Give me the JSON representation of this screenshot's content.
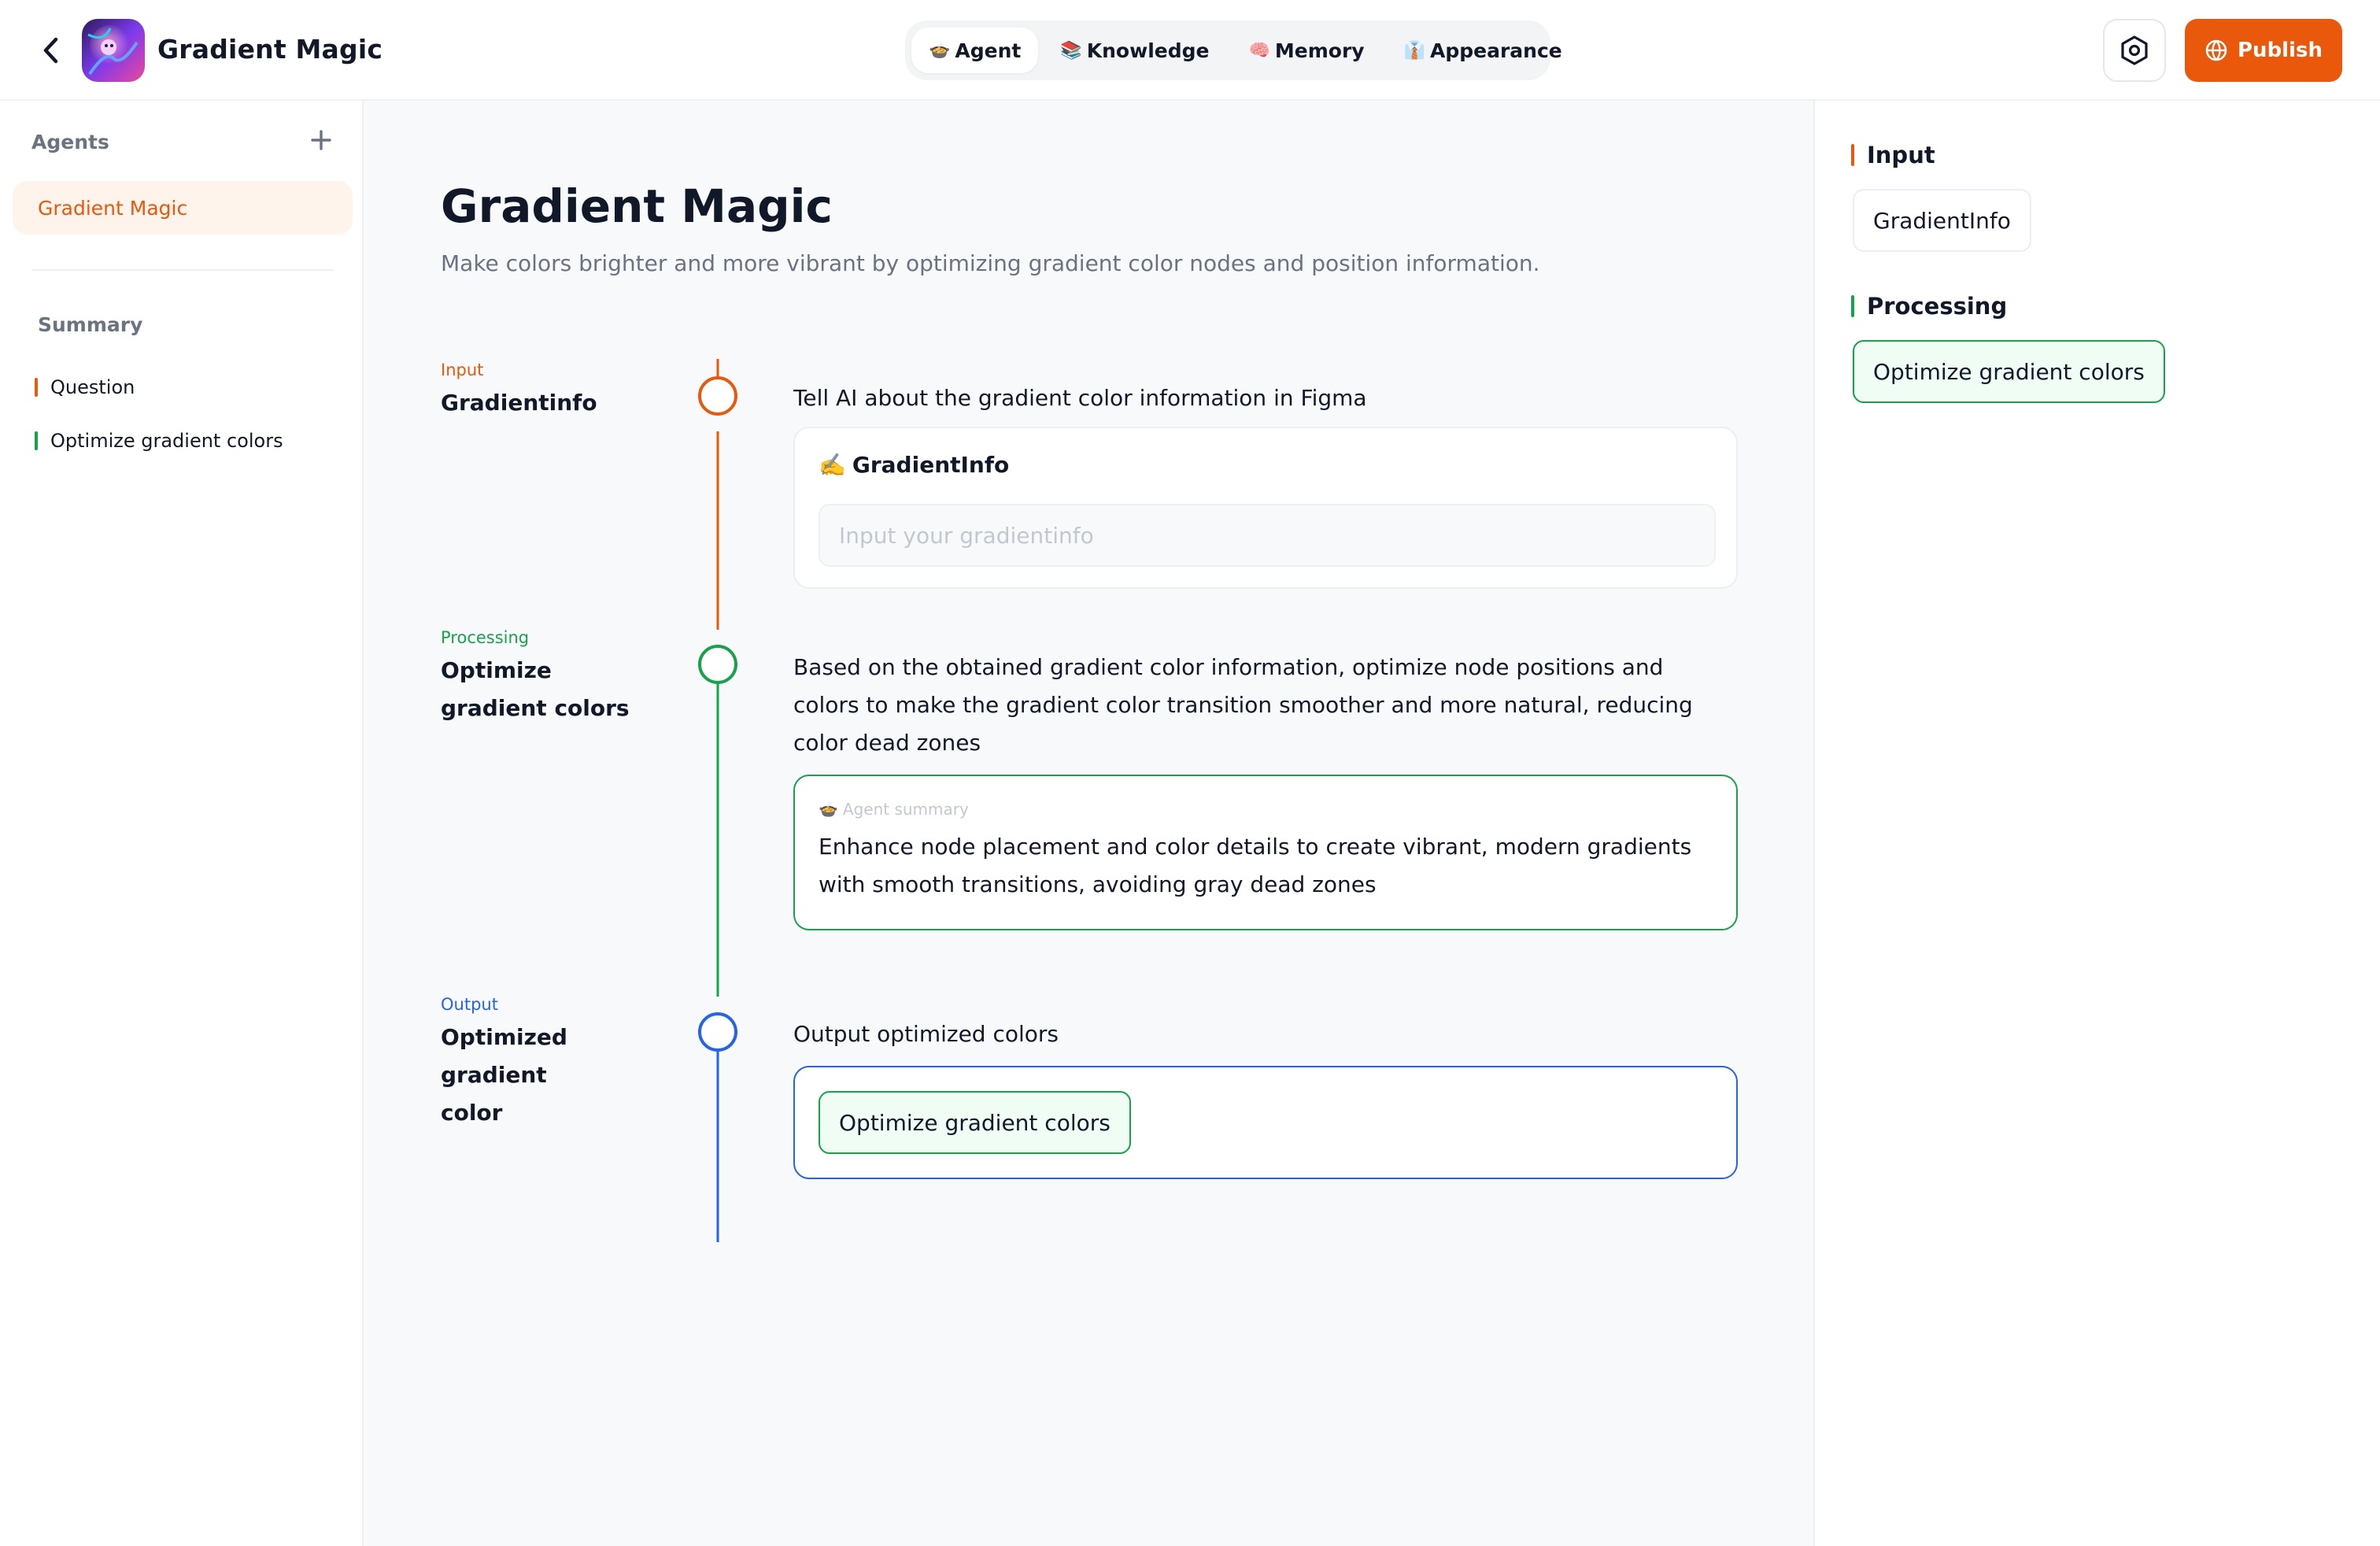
{
  "header": {
    "title": "Gradient Magic",
    "tabs": [
      {
        "label": "Agent",
        "emoji": "🍲"
      },
      {
        "label": "Knowledge",
        "emoji": "📚"
      },
      {
        "label": "Memory",
        "emoji": "🧠"
      },
      {
        "label": "Appearance",
        "emoji": "👔"
      }
    ],
    "publish_label": "Publish"
  },
  "sidebar": {
    "agents_label": "Agents",
    "agents": [
      {
        "label": "Gradient Magic"
      }
    ],
    "summary_label": "Summary",
    "summary_items": [
      {
        "label": "Question",
        "color": "#ea580c"
      },
      {
        "label": "Optimize gradient colors",
        "color": "#16a34a"
      }
    ]
  },
  "main": {
    "title": "Gradient Magic",
    "description": "Make colors brighter and more vibrant by optimizing gradient color nodes and position information.",
    "steps": [
      {
        "tag": "Input",
        "name": "Gradientinfo",
        "color": "#ea580c",
        "instruction": "Tell AI about the gradient color information in Figma",
        "card_label": "GradientInfo",
        "card_emoji": "✍️",
        "input_placeholder": "Input your gradientinfo"
      },
      {
        "tag": "Processing",
        "name": "Optimize gradient colors",
        "color": "#16a34a",
        "instruction": "Based on the obtained gradient color information, optimize node positions and colors to make the gradient color transition smoother and more natural, reducing color dead zones",
        "card_label": "Agent summary",
        "card_emoji": "🍲",
        "summary": "Enhance node placement and color details to create vibrant, modern gradients with smooth transitions, avoiding gray dead zones"
      },
      {
        "tag": "Output",
        "name": "Optimized gradient color",
        "color": "#2563eb",
        "instruction": "Output optimized colors",
        "chip_label": "Optimize gradient colors"
      }
    ]
  },
  "right_panel": {
    "input_heading": "Input",
    "input_item": "GradientInfo",
    "processing_heading": "Processing",
    "processing_item": "Optimize gradient colors"
  },
  "colors": {
    "accent": "#ea580c",
    "processing": "#16a34a",
    "output": "#2563eb"
  }
}
